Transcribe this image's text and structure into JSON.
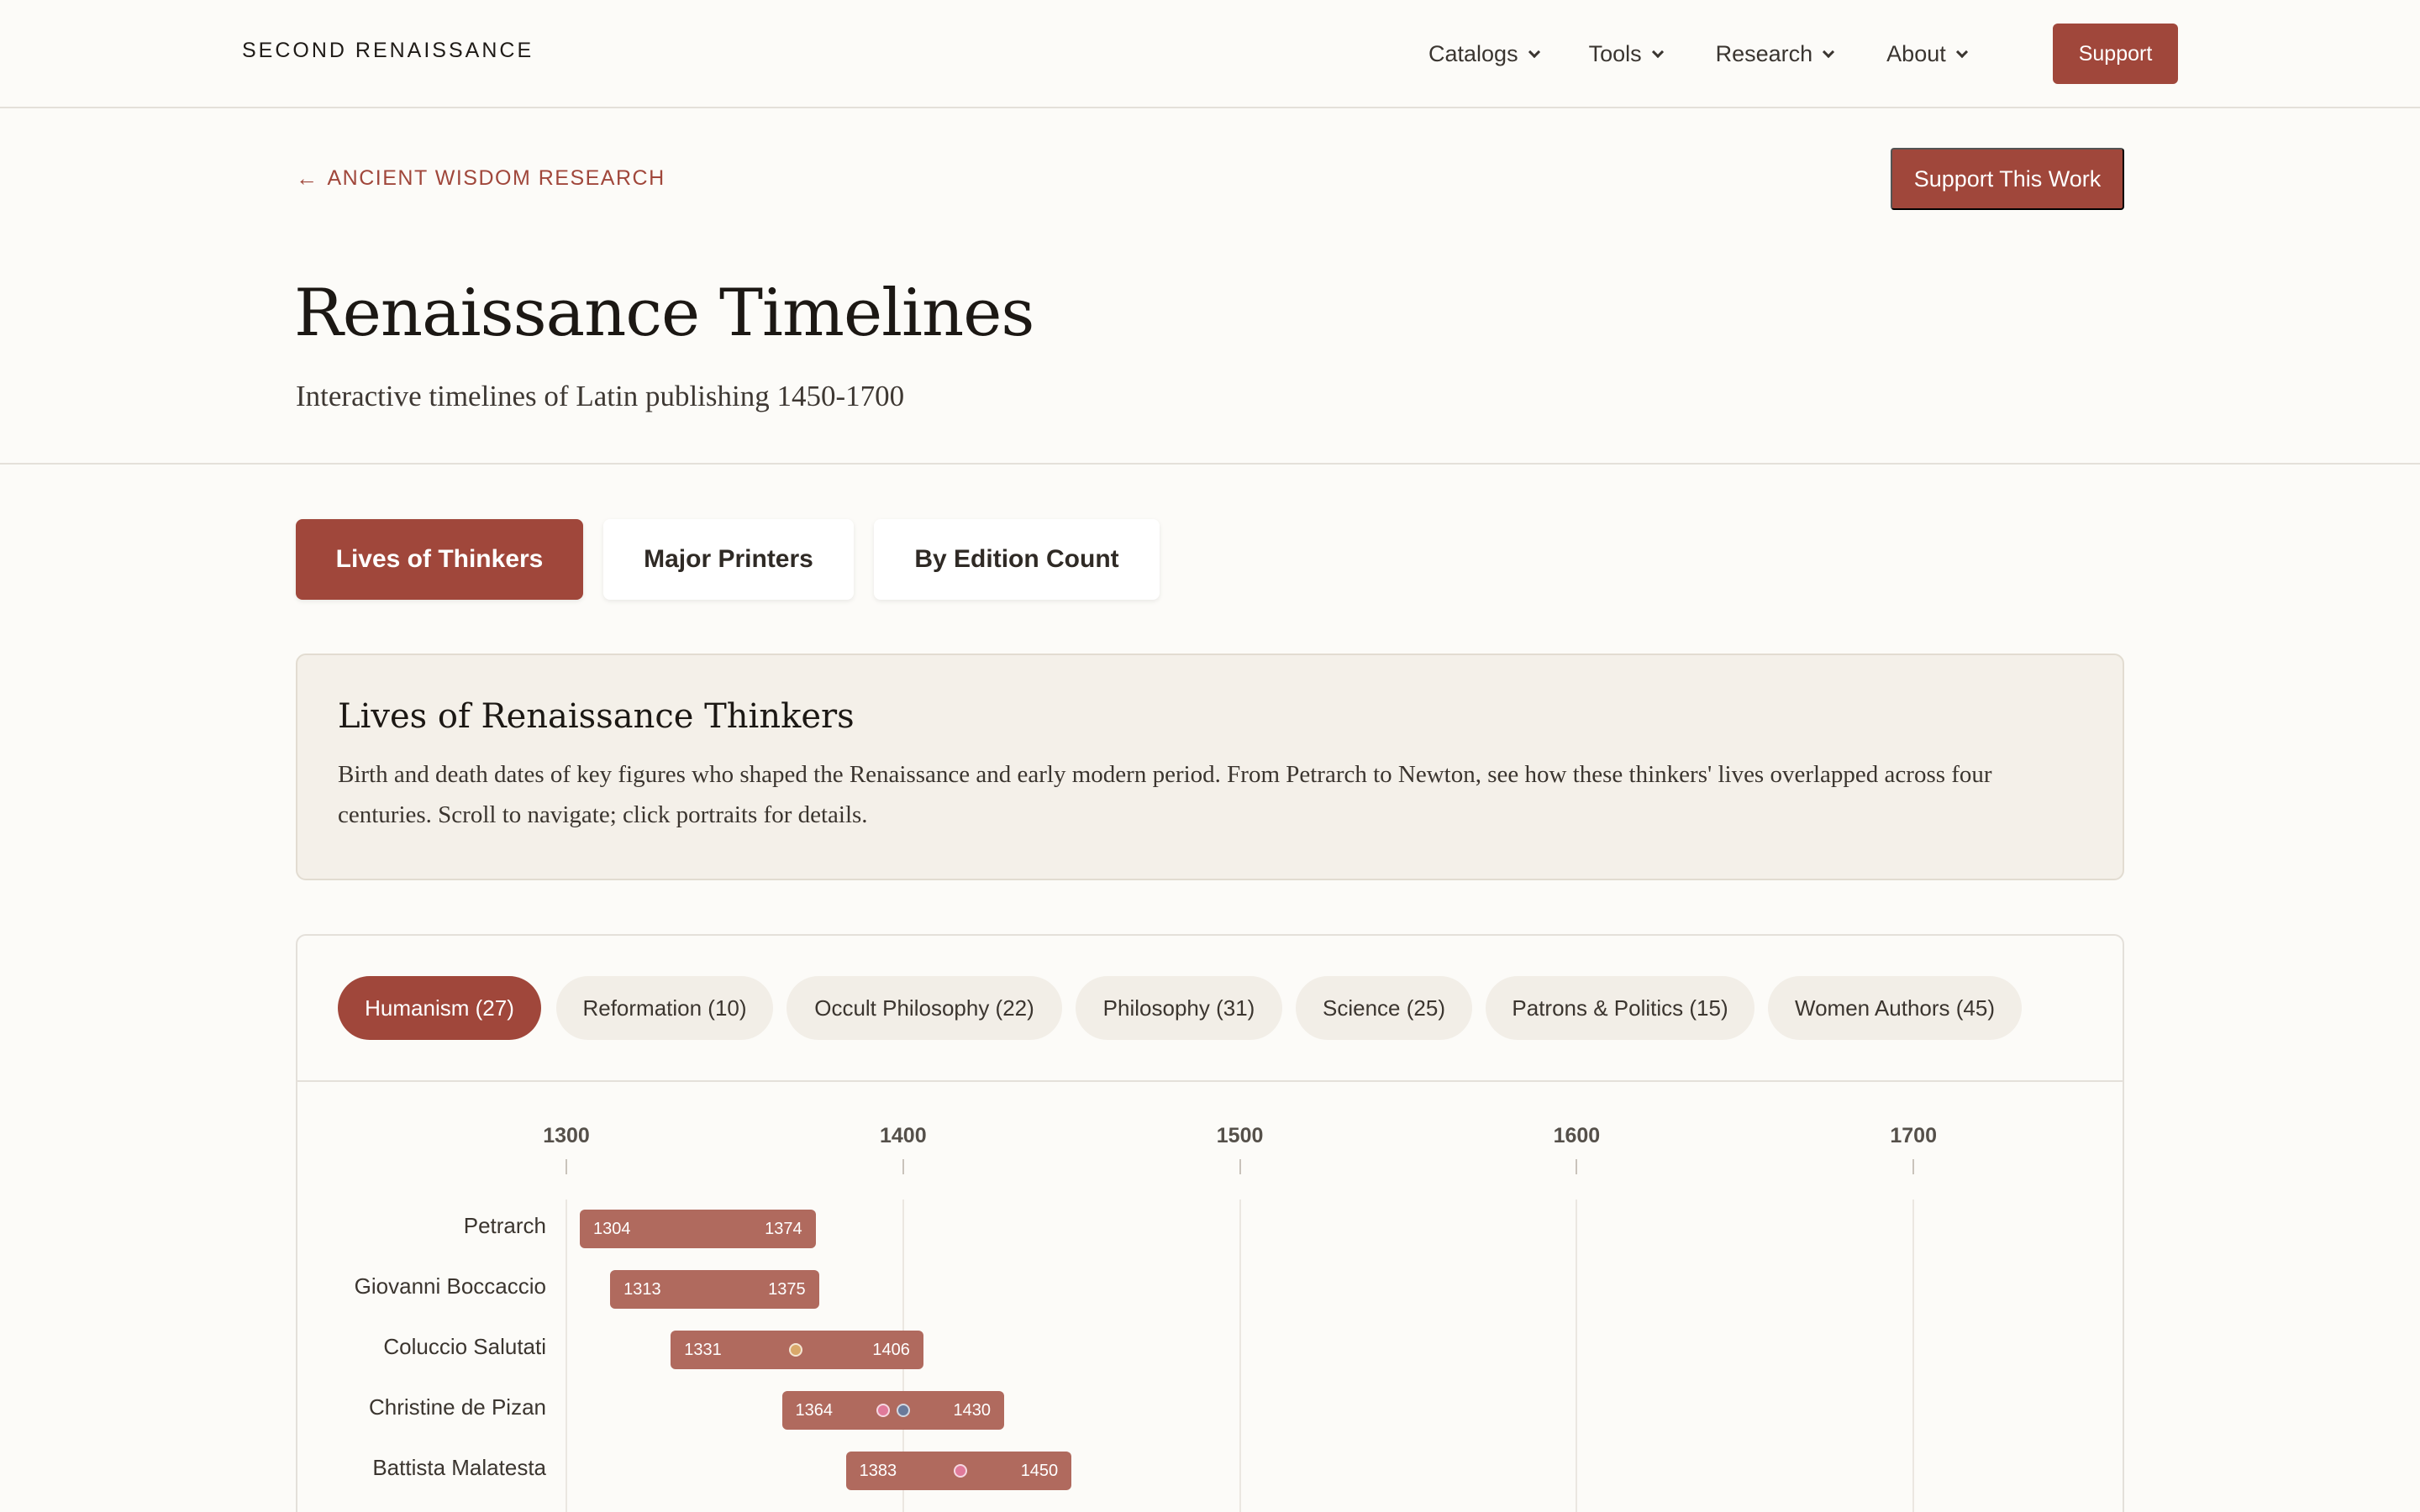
{
  "header": {
    "brand": "SECOND RENAISSANCE",
    "nav": [
      {
        "label": "Catalogs"
      },
      {
        "label": "Tools"
      },
      {
        "label": "Research"
      },
      {
        "label": "About"
      }
    ],
    "support_label": "Support"
  },
  "hero": {
    "back_link": "ANCIENT WISDOM RESEARCH",
    "support_work": "Support This Work",
    "title": "Renaissance Timelines",
    "subtitle": "Interactive timelines of Latin publishing 1450-1700"
  },
  "tabs": [
    {
      "label": "Lives of Thinkers",
      "active": true
    },
    {
      "label": "Major Printers",
      "active": false
    },
    {
      "label": "By Edition Count",
      "active": false
    }
  ],
  "intro": {
    "title": "Lives of Renaissance Thinkers",
    "line1": "Birth and death dates of key figures who shaped the Renaissance and early modern period. From Petrarch to Newton, see how these thinkers' lives overlapped across four",
    "line2": "centuries. Scroll to navigate; click portraits for details."
  },
  "filters": [
    {
      "label": "Humanism (27)",
      "active": true
    },
    {
      "label": "Reformation (10)",
      "active": false
    },
    {
      "label": "Occult Philosophy (22)",
      "active": false
    },
    {
      "label": "Philosophy (31)",
      "active": false
    },
    {
      "label": "Science (25)",
      "active": false
    },
    {
      "label": "Patrons & Politics (15)",
      "active": false
    },
    {
      "label": "Women Authors (45)",
      "active": false
    }
  ],
  "timeline": {
    "axis": [
      "1300",
      "1400",
      "1500",
      "1600",
      "1700"
    ],
    "rows": [
      {
        "name": "Petrarch",
        "born": "1304",
        "died": "1374",
        "markers": []
      },
      {
        "name": "Giovanni Boccaccio",
        "born": "1313",
        "died": "1375",
        "markers": []
      },
      {
        "name": "Coluccio Salutati",
        "born": "1331",
        "died": "1406",
        "markers": [
          {
            "year": 1368,
            "color": "#d9a86a"
          }
        ]
      },
      {
        "name": "Christine de Pizan",
        "born": "1364",
        "died": "1430",
        "markers": [
          {
            "year": 1394,
            "color": "#e07a9a"
          },
          {
            "year": 1400,
            "color": "#6a7a9a"
          }
        ]
      },
      {
        "name": "Battista Malatesta",
        "born": "1383",
        "died": "1450",
        "markers": [
          {
            "year": 1417,
            "color": "#e07a9a"
          }
        ]
      },
      {
        "name": "",
        "born": "",
        "died": "",
        "markers": []
      }
    ]
  },
  "colors": {
    "accent": "#a0473b",
    "bar": "#b06a5e",
    "background": "#fcfbf8"
  }
}
